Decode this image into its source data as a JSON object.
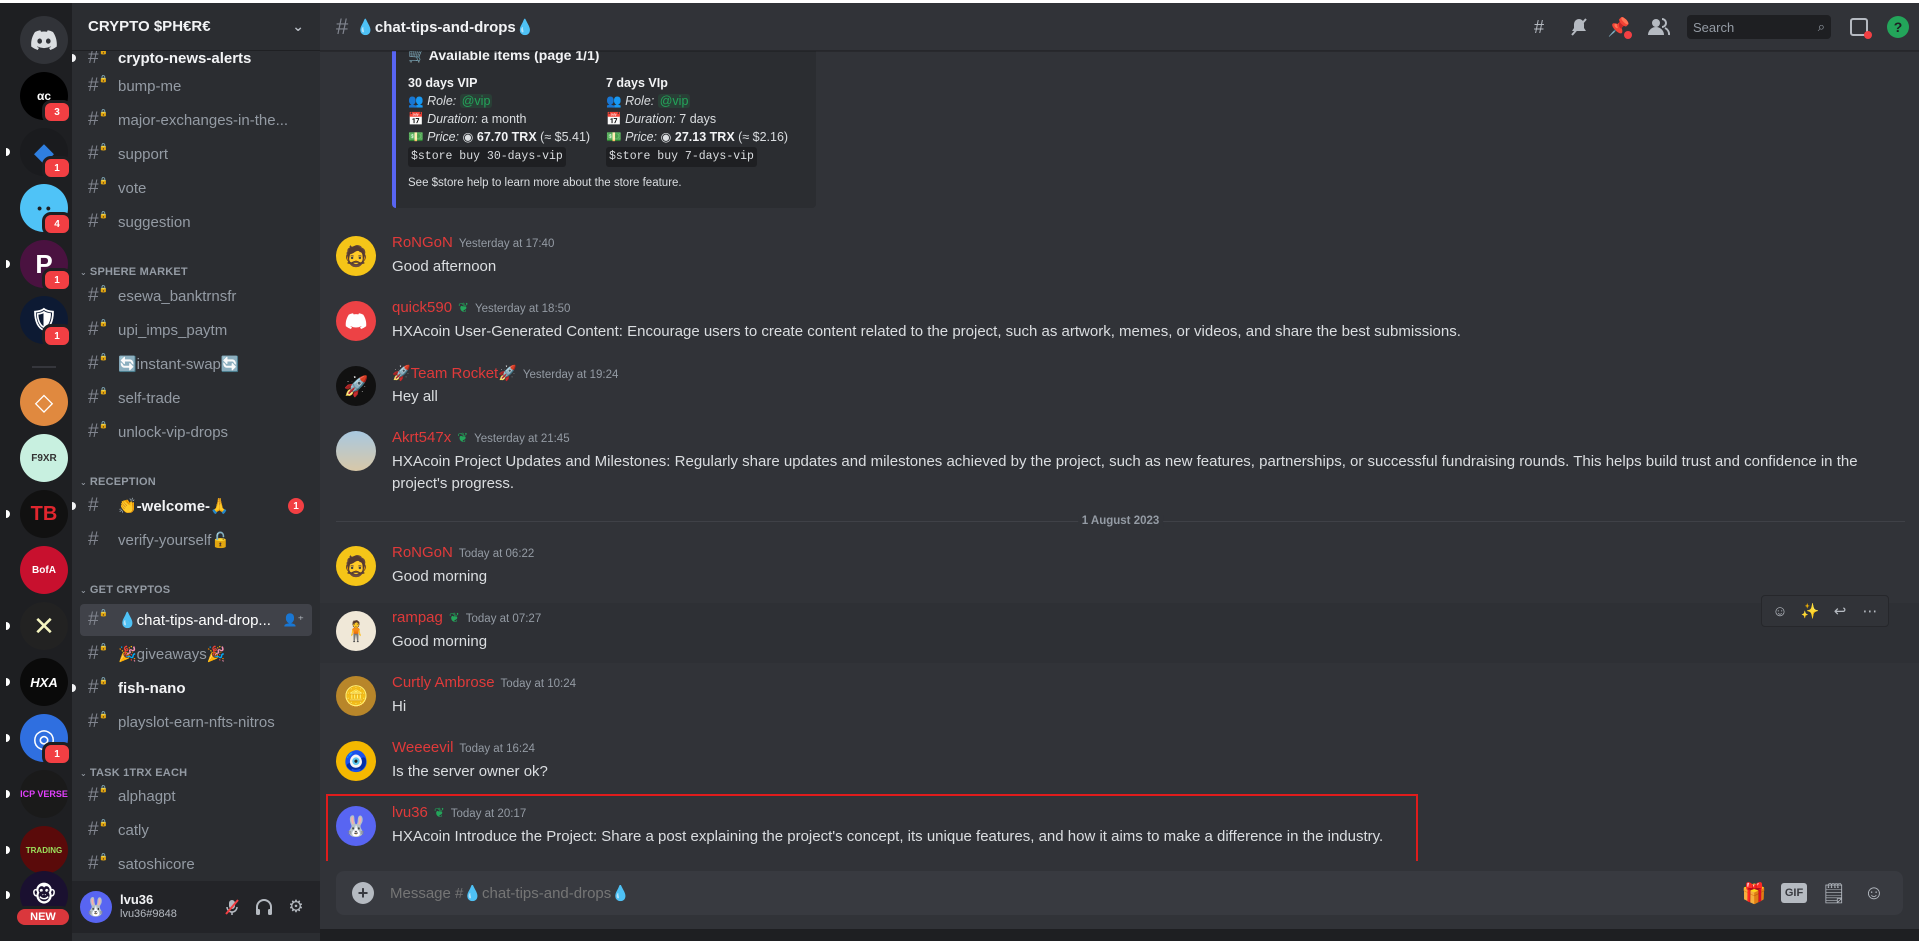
{
  "server": {
    "name": "CRYPTO $PH€R€"
  },
  "guilds": [
    {
      "name": "home",
      "label": "",
      "bg": "#313338",
      "badge": ""
    },
    {
      "name": "ac",
      "label": "αc",
      "bg": "#000000",
      "badge": "3"
    },
    {
      "name": "diamond",
      "label": "◆",
      "bg": "#1a1b1e",
      "badge": "1"
    },
    {
      "name": "smiley",
      "label": "• •",
      "bg": "#4fc3f7",
      "badge": "4"
    },
    {
      "name": "p-server",
      "label": "P",
      "bg": "#4a1240",
      "badge": "1"
    },
    {
      "name": "shield",
      "label": "🛡",
      "bg": "#0d1a33",
      "badge": "1"
    },
    {
      "name": "orange",
      "label": "◇",
      "bg": "#e0893f",
      "badge": ""
    },
    {
      "name": "f9xr",
      "label": "F9XR",
      "bg": "#c8f0e0",
      "badge": ""
    },
    {
      "name": "tb",
      "label": "TB",
      "bg": "#111111",
      "badge": ""
    },
    {
      "name": "bank-of-america",
      "label": "BofA",
      "bg": "#c8102e",
      "badge": ""
    },
    {
      "name": "cross",
      "label": "✕",
      "bg": "#222222",
      "badge": ""
    },
    {
      "name": "hxa",
      "label": "HXA",
      "bg": "#0a0a0a",
      "badge": ""
    },
    {
      "name": "blue-ring",
      "label": "◎",
      "bg": "#2f6fe0",
      "badge": "1"
    },
    {
      "name": "icp-verse",
      "label": "ICP VERSE",
      "bg": "#1a1a1a",
      "badge": ""
    },
    {
      "name": "trading",
      "label": "TRADING",
      "bg": "#5a0a0a",
      "badge": ""
    },
    {
      "name": "monkey",
      "label": "🐵",
      "bg": "#1a1030",
      "badge": ""
    }
  ],
  "new_label": "NEW",
  "sidebar": {
    "channels_top": [
      {
        "name": "crypto-news-alerts",
        "unread": true
      },
      {
        "name": "bump-me"
      },
      {
        "name": "major-exchanges-in-the..."
      },
      {
        "name": "support"
      },
      {
        "name": "vote"
      },
      {
        "name": "suggestion"
      }
    ],
    "categories": [
      {
        "label": "SPHERE MARKET",
        "channels": [
          {
            "name": "esewa_banktrnsfr"
          },
          {
            "name": "upi_imps_paytm"
          },
          {
            "name": "🔄instant-swap🔄"
          },
          {
            "name": "self-trade"
          },
          {
            "name": "unlock-vip-drops"
          }
        ]
      },
      {
        "label": "RECEPTION",
        "channels": [
          {
            "name": "👏-welcome-🙏",
            "unread": true,
            "badge": "1"
          },
          {
            "name": "verify-yourself🔓"
          }
        ]
      },
      {
        "label": "GET CRYPTOS",
        "channels": [
          {
            "name": "💧chat-tips-and-drop...",
            "active": true
          },
          {
            "name": "🎉giveaways🎉"
          },
          {
            "name": "fish-nano",
            "unread": true
          },
          {
            "name": "playslot-earn-nfts-nitros"
          }
        ]
      },
      {
        "label": "TASK 1TRX EACH",
        "channels": [
          {
            "name": "alphagpt"
          },
          {
            "name": "catly"
          },
          {
            "name": "satoshicore"
          }
        ]
      }
    ]
  },
  "user": {
    "name": "lvu36",
    "tag": "lvu36#9848"
  },
  "channel": {
    "title": "💧chat-tips-and-drops💧"
  },
  "header": {
    "search_placeholder": "Search"
  },
  "embed": {
    "title": "🛒 Available items (page 1/1)",
    "items": [
      {
        "name": "30 days VIP",
        "role_label": "Role:",
        "role": "@vip",
        "duration_label": "Duration:",
        "duration": "a month",
        "price_label": "Price:",
        "price": "67.70 TRX",
        "price_usd": "(≈ $5.41)",
        "command": "$store buy 30-days-vip"
      },
      {
        "name": "7 days VIp",
        "role_label": "Role:",
        "role": "@vip",
        "duration_label": "Duration:",
        "duration": "7 days",
        "price_label": "Price:",
        "price": "27.13 TRX",
        "price_usd": "(≈ $2.16)",
        "command": "$store buy 7-days-vip"
      }
    ],
    "footer": "See $store help to learn more about the store feature."
  },
  "messages": [
    {
      "author": "RoNGoN",
      "timestamp": "Yesterday at 17:40",
      "text": "Good afternoon",
      "leaf": false
    },
    {
      "author": "quick590",
      "timestamp": "Yesterday at 18:50",
      "text": "HXAcoin User-Generated Content: Encourage users to create content related to the project, such as artwork, memes, or videos, and share the best submissions.",
      "leaf": true
    },
    {
      "author": "🚀Team Rocket🚀",
      "timestamp": "Yesterday at 19:24",
      "text": "Hey all",
      "leaf": false
    },
    {
      "author": "Akrt547x",
      "timestamp": "Yesterday at 21:45",
      "text": "HXAcoin Project Updates and Milestones: Regularly share updates and milestones achieved by the project, such as new features, partnerships, or successful fundraising rounds. This helps build trust and confidence in the project's progress.",
      "leaf": true
    },
    {
      "author": "RoNGoN",
      "timestamp": "Today at 06:22",
      "text": "Good morning",
      "leaf": false
    },
    {
      "author": "rampag",
      "timestamp": "Today at 07:27",
      "text": "Good morning",
      "leaf": true
    },
    {
      "author": "Curtly Ambrose",
      "timestamp": "Today at 10:24",
      "text": "Hi",
      "leaf": false
    },
    {
      "author": "Weeeevil",
      "timestamp": "Today at 16:24",
      "text": "Is the server owner ok?",
      "leaf": false
    },
    {
      "author": "lvu36",
      "timestamp": "Today at 20:17",
      "text": "HXAcoin Introduce the Project: Share a post explaining the project's concept, its unique features, and how it aims to make a difference in the industry.",
      "leaf": true
    }
  ],
  "date_divider": "1 August 2023",
  "composer": {
    "placeholder": "Message #💧chat-tips-and-drops💧"
  }
}
